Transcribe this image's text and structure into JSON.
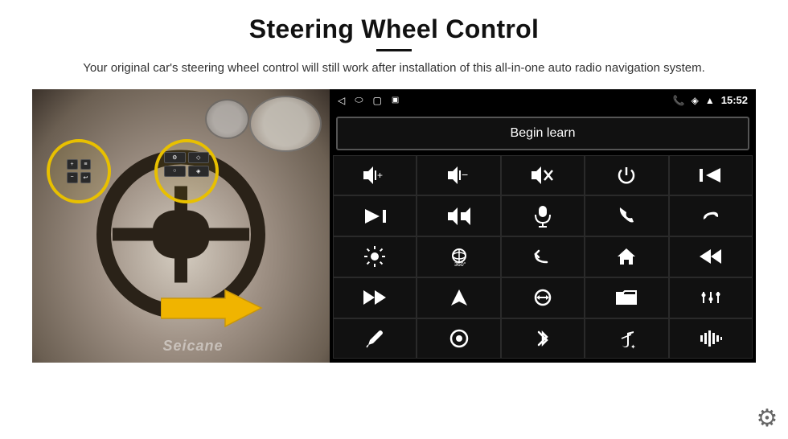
{
  "header": {
    "title": "Steering Wheel Control",
    "subtitle": "Your original car's steering wheel control will still work after installation of this all-in-one auto radio navigation system."
  },
  "statusbar": {
    "time": "15:52",
    "icons_left": [
      "back-arrow",
      "home",
      "square",
      "sim-card"
    ],
    "icons_right": [
      "phone",
      "wifi",
      "signal",
      "time"
    ]
  },
  "begin_learn": {
    "label": "Begin learn"
  },
  "icons": [
    {
      "id": "vol-up",
      "symbol": "🔊+",
      "unicode": ""
    },
    {
      "id": "vol-down",
      "symbol": "🔊−",
      "unicode": ""
    },
    {
      "id": "mute",
      "symbol": "🔇",
      "unicode": ""
    },
    {
      "id": "power",
      "symbol": "⏻",
      "unicode": ""
    },
    {
      "id": "prev-track",
      "symbol": "⏮",
      "unicode": ""
    },
    {
      "id": "play-next",
      "symbol": "⏭",
      "unicode": ""
    },
    {
      "id": "shuffle",
      "symbol": "⇄",
      "unicode": ""
    },
    {
      "id": "mic",
      "symbol": "🎤",
      "unicode": ""
    },
    {
      "id": "phone",
      "symbol": "📞",
      "unicode": ""
    },
    {
      "id": "hang-up",
      "symbol": "📵",
      "unicode": ""
    },
    {
      "id": "brightness",
      "symbol": "🔆",
      "unicode": ""
    },
    {
      "id": "360-view",
      "symbol": "👁",
      "unicode": ""
    },
    {
      "id": "undo",
      "symbol": "↩",
      "unicode": ""
    },
    {
      "id": "home-nav",
      "symbol": "⌂",
      "unicode": ""
    },
    {
      "id": "rewind",
      "symbol": "⏮",
      "unicode": ""
    },
    {
      "id": "fast-forward",
      "symbol": "⏩",
      "unicode": ""
    },
    {
      "id": "navigate",
      "symbol": "▶",
      "unicode": ""
    },
    {
      "id": "swap",
      "symbol": "⇄",
      "unicode": ""
    },
    {
      "id": "folder",
      "symbol": "📁",
      "unicode": ""
    },
    {
      "id": "settings-eq",
      "symbol": "🎛",
      "unicode": ""
    },
    {
      "id": "pen",
      "symbol": "✏",
      "unicode": ""
    },
    {
      "id": "circle-dot",
      "symbol": "⊙",
      "unicode": ""
    },
    {
      "id": "bluetooth",
      "symbol": "⚡",
      "unicode": ""
    },
    {
      "id": "music",
      "symbol": "♫",
      "unicode": ""
    },
    {
      "id": "equalizer",
      "symbol": "▋▋▋",
      "unicode": ""
    }
  ],
  "seicane_watermark": "Seicane",
  "gear_icon": "⚙"
}
